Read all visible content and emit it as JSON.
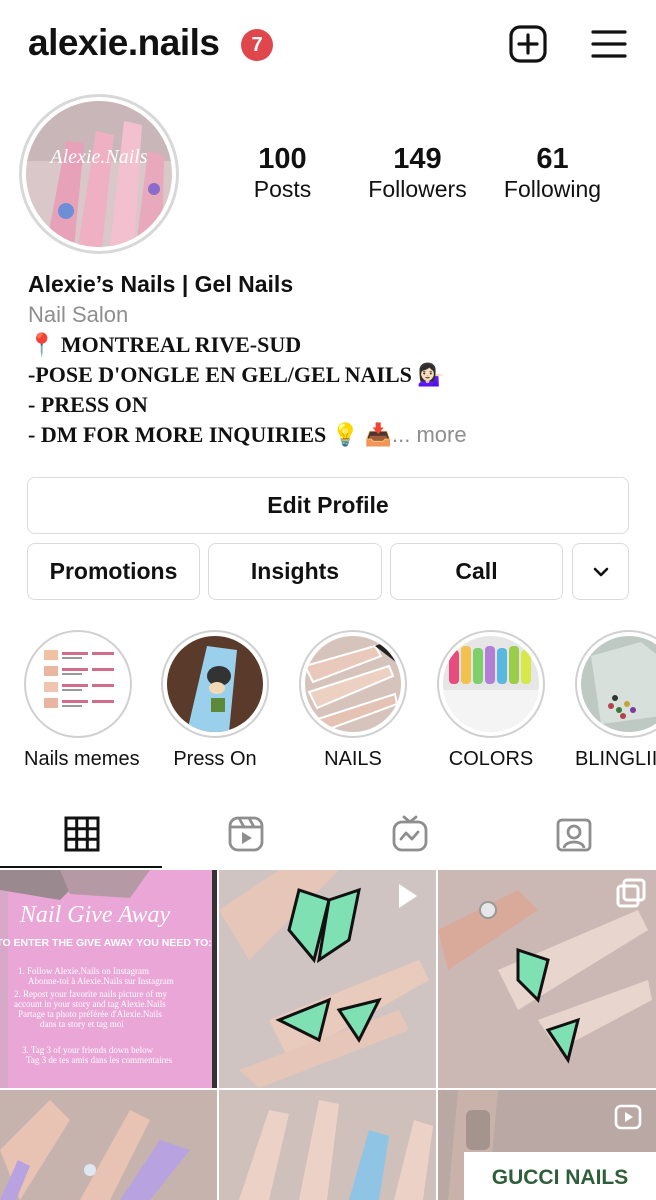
{
  "header": {
    "username": "alexie.nails",
    "notifications": "7"
  },
  "profile": {
    "stats": [
      {
        "value": "100",
        "label": "Posts"
      },
      {
        "value": "149",
        "label": "Followers"
      },
      {
        "value": "61",
        "label": "Following"
      }
    ],
    "avatar_text": "Alexie.Nails",
    "name": "Alexie’s Nails | Gel Nails",
    "category": "Nail Salon",
    "bio_lines": [
      "📍 MONTREAL RIVE-SUD",
      "-POSE D'ONGLE EN GEL/GEL NAILS 💁🏻‍♀️",
      "- PRESS ON",
      "- DM FOR MORE INQUIRIES 💡 📥"
    ],
    "bio_more": "... more"
  },
  "buttons": {
    "edit_profile": "Edit Profile",
    "promotions": "Promotions",
    "insights": "Insights",
    "call": "Call"
  },
  "highlights": [
    {
      "label": "Nails memes"
    },
    {
      "label": "Press On"
    },
    {
      "label": "NAILS"
    },
    {
      "label": "COLORS"
    },
    {
      "label": "BLINGLII"
    }
  ],
  "tabs": [
    "grid",
    "reels",
    "igtv",
    "tagged"
  ],
  "posts": {
    "giveaway": {
      "title": "Nail Give Away",
      "subtitle": "TO ENTER THE GIVE AWAY YOU NEED TO:",
      "lines": [
        "1. Follow Alexie.Nails on Instagram",
        "Abonne-toi à Alexie.Nails sur Instagram",
        "2. Repost your favorite nails picture of my",
        "account in your story and tag Alexie.Nails",
        "Partage ta photo préférée d'Alexie.Nails",
        "dans ta story et tag moi",
        "3. Tag 3 of your friends down below",
        "Tag 3 de tes amis dans les commentaires"
      ]
    },
    "gucci": "GUCCI NAILS"
  },
  "colors": {
    "badge": "#e0474c",
    "border": "#dbdbdb",
    "muted": "#8e8e8e",
    "pink": "#e9a6d7",
    "mint": "#7fe0b4"
  }
}
